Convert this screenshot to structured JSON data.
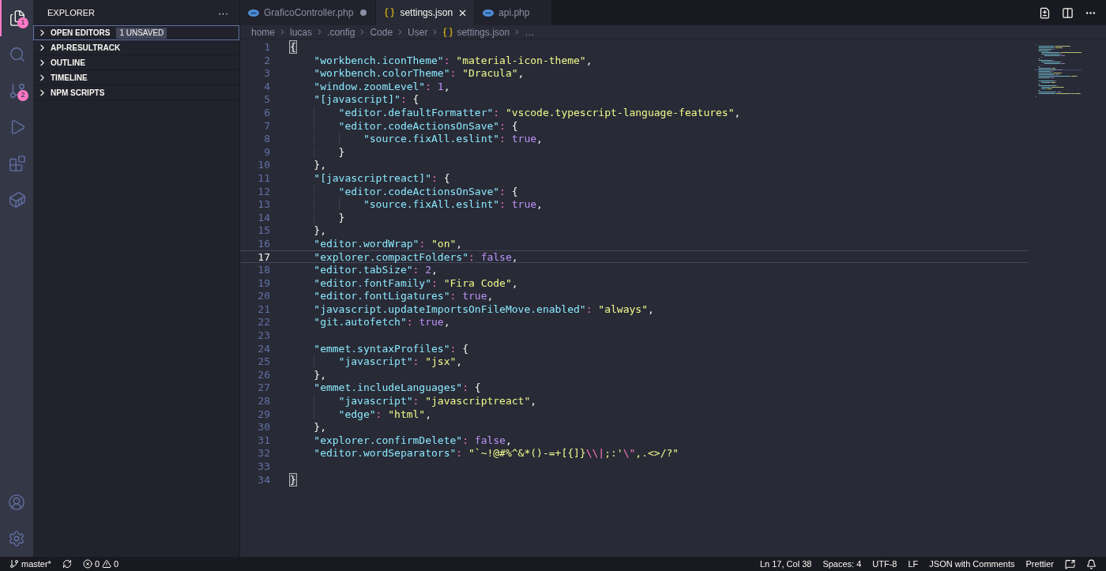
{
  "activity_bar": {
    "items": [
      {
        "kind": "files",
        "selected": true,
        "badge": "1"
      },
      {
        "kind": "search",
        "selected": false
      },
      {
        "kind": "source-control",
        "selected": false,
        "badge": "2"
      },
      {
        "kind": "run",
        "selected": false
      },
      {
        "kind": "extensions",
        "selected": false
      },
      {
        "kind": "docker",
        "selected": false
      }
    ],
    "bottom": [
      {
        "kind": "account"
      },
      {
        "kind": "settings"
      }
    ]
  },
  "sidebar": {
    "title": "EXPLORER",
    "more": "···",
    "sections": [
      {
        "label": "OPEN EDITORS",
        "badge": "1 UNSAVED",
        "expanded": false,
        "focused": true
      },
      {
        "label": "API-RESULTRACK",
        "expanded": false,
        "focused": false
      },
      {
        "label": "OUTLINE",
        "expanded": false,
        "focused": false
      },
      {
        "label": "TIMELINE",
        "expanded": false,
        "focused": false
      },
      {
        "label": "NPM SCRIPTS",
        "expanded": false,
        "focused": false
      }
    ]
  },
  "tabs": [
    {
      "label": "GraficoController.php",
      "kind": "php",
      "selected": false,
      "modified": true
    },
    {
      "label": "settings.json",
      "kind": "json",
      "selected": true,
      "modified": false
    },
    {
      "label": "api.php",
      "kind": "php",
      "selected": false,
      "modified": false
    }
  ],
  "breadcrumbs": [
    {
      "label": "home"
    },
    {
      "label": "lucas"
    },
    {
      "label": ".config"
    },
    {
      "label": "Code"
    },
    {
      "label": "User"
    },
    {
      "label": "settings.json",
      "kind": "json"
    },
    {
      "label": "…"
    }
  ],
  "code_lines": [
    {
      "number": "1",
      "current": false,
      "bracket_match": true,
      "tokens": [
        {
          "kind": "punct",
          "text": "{"
        }
      ]
    },
    {
      "number": "2",
      "current": false,
      "bracket_match": false,
      "tokens": [
        {
          "kind": "key",
          "text": "    \"workbench.iconTheme\""
        },
        {
          "kind": "colon",
          "text": ": "
        },
        {
          "kind": "string",
          "text": "\"material-icon-theme\""
        },
        {
          "kind": "punct",
          "text": ","
        }
      ]
    },
    {
      "number": "3",
      "current": false,
      "bracket_match": false,
      "tokens": [
        {
          "kind": "key",
          "text": "    \"workbench.colorTheme\""
        },
        {
          "kind": "colon",
          "text": ": "
        },
        {
          "kind": "string",
          "text": "\"Dracula\""
        },
        {
          "kind": "punct",
          "text": ","
        }
      ]
    },
    {
      "number": "4",
      "current": false,
      "bracket_match": false,
      "tokens": [
        {
          "kind": "key",
          "text": "    \"window.zoomLevel\""
        },
        {
          "kind": "colon",
          "text": ": "
        },
        {
          "kind": "number",
          "text": "1"
        },
        {
          "kind": "punct",
          "text": ","
        }
      ]
    },
    {
      "number": "5",
      "current": false,
      "bracket_match": false,
      "tokens": [
        {
          "kind": "key",
          "text": "    \"[javascript]\""
        },
        {
          "kind": "colon",
          "text": ": "
        },
        {
          "kind": "punct",
          "text": "{"
        }
      ]
    },
    {
      "number": "6",
      "current": false,
      "bracket_match": false,
      "tokens": [
        {
          "kind": "key",
          "text": "        \"editor.defaultFormatter\""
        },
        {
          "kind": "colon",
          "text": ": "
        },
        {
          "kind": "string",
          "text": "\"vscode.typescript-language-features\""
        },
        {
          "kind": "punct",
          "text": ","
        }
      ]
    },
    {
      "number": "7",
      "current": false,
      "bracket_match": false,
      "tokens": [
        {
          "kind": "key",
          "text": "        \"editor.codeActionsOnSave\""
        },
        {
          "kind": "colon",
          "text": ": "
        },
        {
          "kind": "punct",
          "text": "{"
        }
      ]
    },
    {
      "number": "8",
      "current": false,
      "bracket_match": false,
      "tokens": [
        {
          "kind": "key",
          "text": "            \"source.fixAll.eslint\""
        },
        {
          "kind": "colon",
          "text": ": "
        },
        {
          "kind": "number",
          "text": "true"
        },
        {
          "kind": "punct",
          "text": ","
        }
      ]
    },
    {
      "number": "9",
      "current": false,
      "bracket_match": false,
      "tokens": [
        {
          "kind": "punct",
          "text": "        }"
        }
      ]
    },
    {
      "number": "10",
      "current": false,
      "bracket_match": false,
      "tokens": [
        {
          "kind": "punct",
          "text": "    },"
        }
      ]
    },
    {
      "number": "11",
      "current": false,
      "bracket_match": false,
      "tokens": [
        {
          "kind": "key",
          "text": "    \"[javascriptreact]\""
        },
        {
          "kind": "colon",
          "text": ": "
        },
        {
          "kind": "punct",
          "text": "{"
        }
      ]
    },
    {
      "number": "12",
      "current": false,
      "bracket_match": false,
      "tokens": [
        {
          "kind": "key",
          "text": "        \"editor.codeActionsOnSave\""
        },
        {
          "kind": "colon",
          "text": ": "
        },
        {
          "kind": "punct",
          "text": "{"
        }
      ]
    },
    {
      "number": "13",
      "current": false,
      "bracket_match": false,
      "tokens": [
        {
          "kind": "key",
          "text": "            \"source.fixAll.eslint\""
        },
        {
          "kind": "colon",
          "text": ": "
        },
        {
          "kind": "number",
          "text": "true"
        },
        {
          "kind": "punct",
          "text": ","
        }
      ]
    },
    {
      "number": "14",
      "current": false,
      "bracket_match": false,
      "tokens": [
        {
          "kind": "punct",
          "text": "        }"
        }
      ]
    },
    {
      "number": "15",
      "current": false,
      "bracket_match": false,
      "tokens": [
        {
          "kind": "punct",
          "text": "    },"
        }
      ]
    },
    {
      "number": "16",
      "current": false,
      "bracket_match": false,
      "tokens": [
        {
          "kind": "key",
          "text": "    \"editor.wordWrap\""
        },
        {
          "kind": "colon",
          "text": ": "
        },
        {
          "kind": "string",
          "text": "\"on\""
        },
        {
          "kind": "punct",
          "text": ","
        }
      ]
    },
    {
      "number": "17",
      "current": true,
      "bracket_match": false,
      "tokens": [
        {
          "kind": "key",
          "text": "    \"explorer.compactFolders\""
        },
        {
          "kind": "colon",
          "text": ": "
        },
        {
          "kind": "number",
          "text": "false"
        },
        {
          "kind": "punct",
          "text": ","
        }
      ]
    },
    {
      "number": "18",
      "current": false,
      "bracket_match": false,
      "tokens": [
        {
          "kind": "key",
          "text": "    \"editor.tabSize\""
        },
        {
          "kind": "colon",
          "text": ": "
        },
        {
          "kind": "number",
          "text": "2"
        },
        {
          "kind": "punct",
          "text": ","
        }
      ]
    },
    {
      "number": "19",
      "current": false,
      "bracket_match": false,
      "tokens": [
        {
          "kind": "key",
          "text": "    \"editor.fontFamily\""
        },
        {
          "kind": "colon",
          "text": ": "
        },
        {
          "kind": "string",
          "text": "\"Fira Code\""
        },
        {
          "kind": "punct",
          "text": ","
        }
      ]
    },
    {
      "number": "20",
      "current": false,
      "bracket_match": false,
      "tokens": [
        {
          "kind": "key",
          "text": "    \"editor.fontLigatures\""
        },
        {
          "kind": "colon",
          "text": ": "
        },
        {
          "kind": "number",
          "text": "true"
        },
        {
          "kind": "punct",
          "text": ","
        }
      ]
    },
    {
      "number": "21",
      "current": false,
      "bracket_match": false,
      "tokens": [
        {
          "kind": "key",
          "text": "    \"javascript.updateImportsOnFileMove.enabled\""
        },
        {
          "kind": "colon",
          "text": ": "
        },
        {
          "kind": "string",
          "text": "\"always\""
        },
        {
          "kind": "punct",
          "text": ","
        }
      ]
    },
    {
      "number": "22",
      "current": false,
      "bracket_match": false,
      "tokens": [
        {
          "kind": "key",
          "text": "    \"git.autofetch\""
        },
        {
          "kind": "colon",
          "text": ": "
        },
        {
          "kind": "number",
          "text": "true"
        },
        {
          "kind": "punct",
          "text": ","
        }
      ]
    },
    {
      "number": "23",
      "current": false,
      "bracket_match": false
    },
    {
      "number": "24",
      "current": false,
      "bracket_match": false,
      "tokens": [
        {
          "kind": "key",
          "text": "    \"emmet.syntaxProfiles\""
        },
        {
          "kind": "colon",
          "text": ": "
        },
        {
          "kind": "punct",
          "text": "{"
        }
      ]
    },
    {
      "number": "25",
      "current": false,
      "bracket_match": false,
      "tokens": [
        {
          "kind": "key",
          "text": "        \"javascript\""
        },
        {
          "kind": "colon",
          "text": ": "
        },
        {
          "kind": "string",
          "text": "\"jsx\""
        },
        {
          "kind": "punct",
          "text": ","
        }
      ]
    },
    {
      "number": "26",
      "current": false,
      "bracket_match": false,
      "tokens": [
        {
          "kind": "punct",
          "text": "    },"
        }
      ]
    },
    {
      "number": "27",
      "current": false,
      "bracket_match": false,
      "tokens": [
        {
          "kind": "key",
          "text": "    \"emmet.includeLanguages\""
        },
        {
          "kind": "colon",
          "text": ": "
        },
        {
          "kind": "punct",
          "text": "{"
        }
      ]
    },
    {
      "number": "28",
      "current": false,
      "bracket_match": false,
      "tokens": [
        {
          "kind": "key",
          "text": "        \"javascript\""
        },
        {
          "kind": "colon",
          "text": ": "
        },
        {
          "kind": "string",
          "text": "\"javascriptreact\""
        },
        {
          "kind": "punct",
          "text": ","
        }
      ]
    },
    {
      "number": "29",
      "current": false,
      "bracket_match": false,
      "tokens": [
        {
          "kind": "key",
          "text": "        \"edge\""
        },
        {
          "kind": "colon",
          "text": ": "
        },
        {
          "kind": "string",
          "text": "\"html\""
        },
        {
          "kind": "punct",
          "text": ","
        }
      ]
    },
    {
      "number": "30",
      "current": false,
      "bracket_match": false,
      "tokens": [
        {
          "kind": "punct",
          "text": "    },"
        }
      ]
    },
    {
      "number": "31",
      "current": false,
      "bracket_match": false,
      "tokens": [
        {
          "kind": "key",
          "text": "    \"explorer.confirmDelete\""
        },
        {
          "kind": "colon",
          "text": ": "
        },
        {
          "kind": "number",
          "text": "false"
        },
        {
          "kind": "punct",
          "text": ","
        }
      ]
    },
    {
      "number": "32",
      "current": false,
      "bracket_match": false,
      "tokens": [
        {
          "kind": "key",
          "text": "    \"editor.wordSeparators\""
        },
        {
          "kind": "colon",
          "text": ": "
        },
        {
          "kind": "string",
          "text": "\"`~!@#%^&*()-=+[{]}"
        },
        {
          "kind": "escape",
          "text": "\\\\|"
        },
        {
          "kind": "string",
          "text": ";:'"
        },
        {
          "kind": "escape",
          "text": "\\\""
        },
        {
          "kind": "string",
          "text": ",.<>/?\""
        }
      ]
    },
    {
      "number": "33",
      "current": false,
      "bracket_match": false
    },
    {
      "number": "34",
      "current": false,
      "bracket_match": true,
      "tokens": [
        {
          "kind": "punct",
          "text": "}"
        }
      ]
    }
  ],
  "status_bar": {
    "branch": "master*",
    "errors": "0",
    "warnings": "0",
    "right": [
      {
        "label": "Ln 17, Col 38"
      },
      {
        "label": "Spaces: 4"
      },
      {
        "label": "UTF-8"
      },
      {
        "label": "LF"
      },
      {
        "label": "JSON with Comments"
      },
      {
        "label": "Prettier"
      }
    ]
  }
}
